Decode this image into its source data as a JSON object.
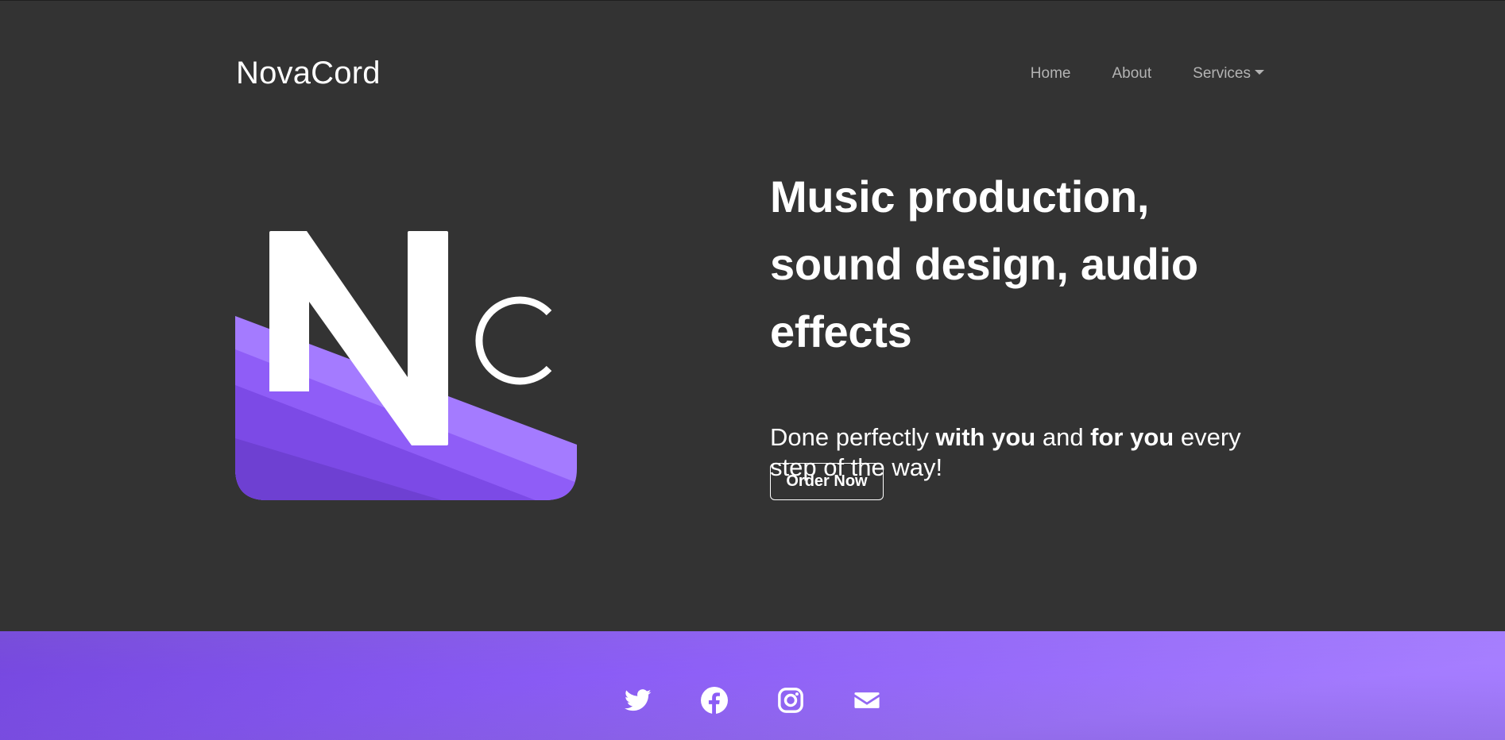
{
  "navbar": {
    "brand": "NovaCord",
    "links": [
      {
        "label": "Home"
      },
      {
        "label": "About"
      },
      {
        "label": "Services"
      }
    ]
  },
  "hero": {
    "headline": "Music production, sound design, audio effects",
    "sub_parts": [
      "Done perfectly ",
      "with you",
      " and ",
      "for you",
      " every step of the way!"
    ],
    "cta_label": "Order Now",
    "logo_letters": {
      "big": "N",
      "small": "C"
    }
  },
  "footer": {
    "social": [
      {
        "icon": "twitter-icon"
      },
      {
        "icon": "facebook-icon"
      },
      {
        "icon": "instagram-icon"
      },
      {
        "icon": "email-icon"
      }
    ]
  },
  "colors": {
    "background": "#333333",
    "accent_light": "#a47bff",
    "accent_mid": "#8b5cf6",
    "accent_dark": "#6d3fd6"
  }
}
